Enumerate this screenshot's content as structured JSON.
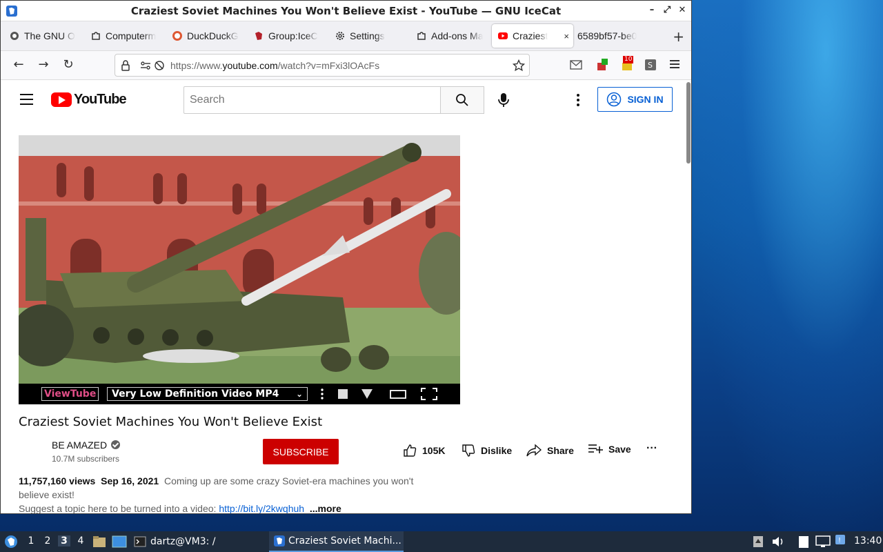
{
  "window": {
    "title": "Craziest Soviet Machines You Won't Believe Exist - YouTube — GNU IceCat",
    "controls": {
      "minimize": "–",
      "maximize": "⤢",
      "close": "✕"
    }
  },
  "tabs": [
    {
      "label": "The GNU O",
      "icon": "gnu-icon"
    },
    {
      "label": "Computerm",
      "icon": "puzzle-icon"
    },
    {
      "label": "DuckDuckG",
      "icon": "duckduckgo-icon"
    },
    {
      "label": "Group:IceC",
      "icon": "icecat-icon"
    },
    {
      "label": "Settings",
      "icon": "gear-icon"
    },
    {
      "label": "Add-ons Ma",
      "icon": "puzzle-icon"
    },
    {
      "label": "Craziest",
      "icon": "youtube-icon",
      "active": true,
      "close": "×"
    },
    {
      "label": "6589bf57-be0",
      "icon": ""
    }
  ],
  "newtab_label": "+",
  "navbar": {
    "back": "←",
    "forward": "→",
    "reload": "↻",
    "url_prefix": "https://www.",
    "url_domain": "youtube.com",
    "url_path": "/watch?v=mFxi3lOAcFs",
    "badge_count": "10"
  },
  "youtube": {
    "logo_text": "YouTube",
    "search_placeholder": "Search",
    "sign_in": "SIGN IN",
    "player": {
      "viewtube": "ViewTube",
      "quality": "Very Low Definition Video MP4",
      "quality_chevron": "⌄"
    },
    "video_title": "Craziest Soviet Machines You Won't Believe Exist",
    "channel_name": "BE AMAZED",
    "subscribers": "10.7M subscribers",
    "subscribe": "SUBSCRIBE",
    "likes": "105K",
    "dislike": "Dislike",
    "share": "Share",
    "save": "Save",
    "more_actions": "···",
    "views": "11,757,160 views",
    "date": "Sep 16, 2021",
    "description_1": "Coming up are some crazy Soviet-era machines you won't believe exist!",
    "description_2": "Suggest a topic here to be turned into a video:",
    "link": "http://bit.ly/2kwqhuh",
    "more": "...more"
  },
  "taskbar": {
    "workspaces": [
      "1",
      "2",
      "3",
      "4"
    ],
    "active_workspace": "3",
    "terminal": "dartz@VM3: /",
    "window_button": "Craziest Soviet Machi...",
    "clock": "13:40"
  },
  "colors": {
    "youtube_red": "#ff0000",
    "subscribe_red": "#cc0000",
    "link_blue": "#065fd4",
    "taskbar": "#1e2b3c",
    "viewtube_pink": "#e04e87"
  }
}
